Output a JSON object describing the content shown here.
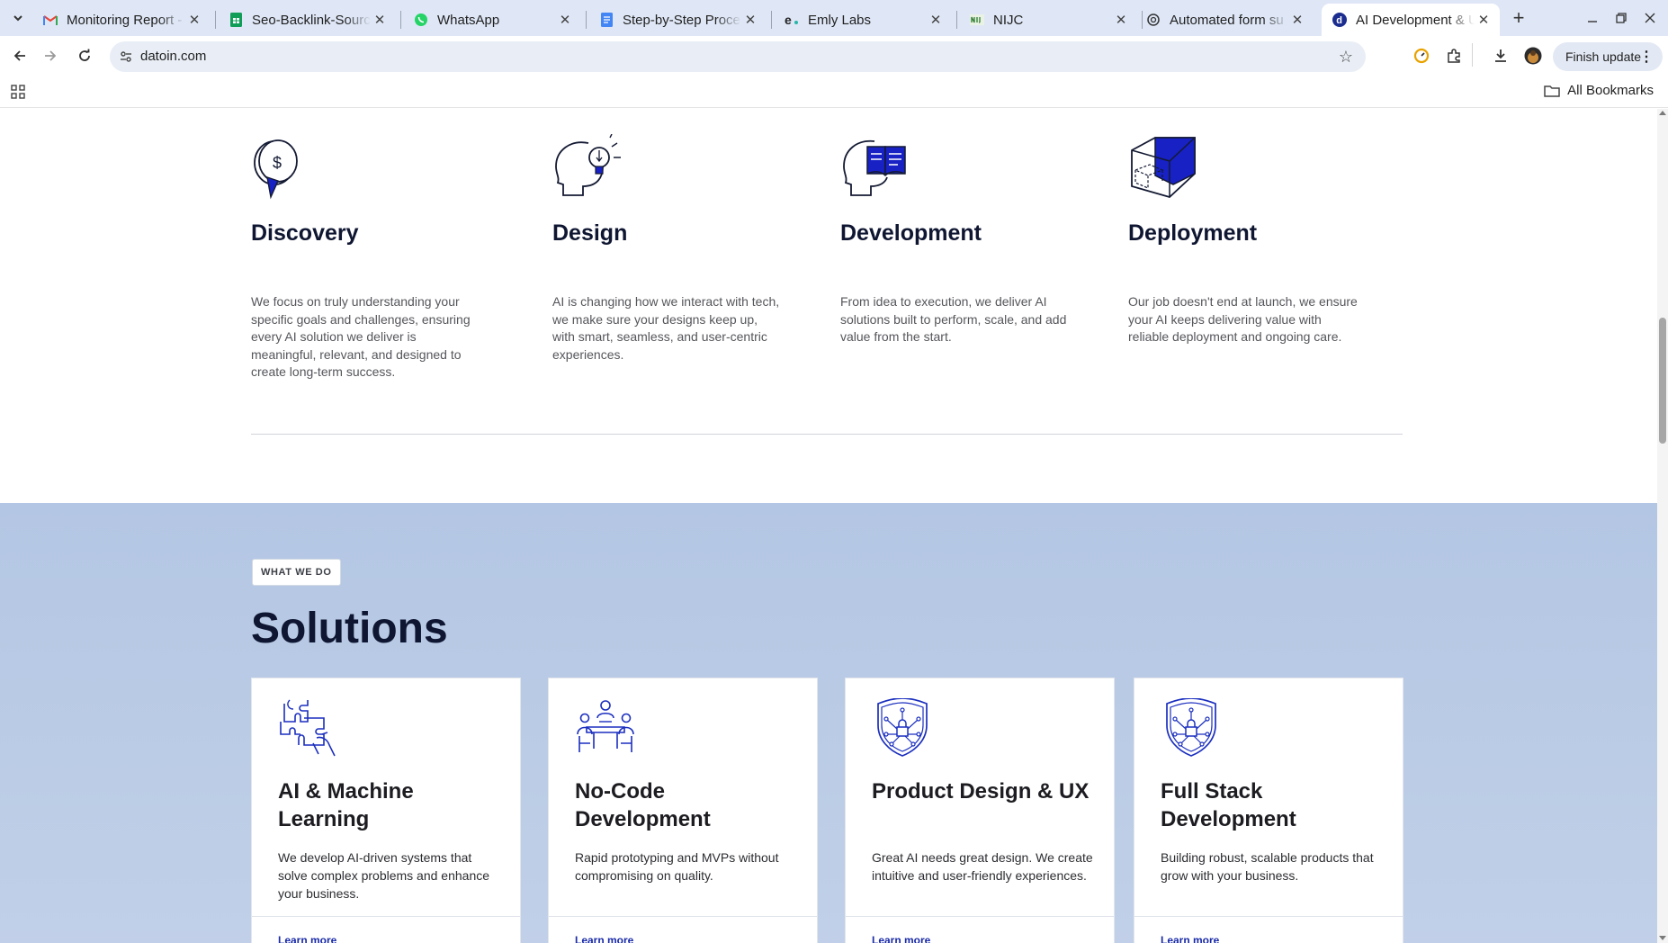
{
  "browser": {
    "tabs": [
      {
        "title": "Monitoring Report -",
        "icon": "gmail-icon"
      },
      {
        "title": "Seo-Backlink-Source",
        "icon": "sheets-icon"
      },
      {
        "title": "WhatsApp",
        "icon": "whatsapp-icon"
      },
      {
        "title": "Step-by-Step Proce",
        "icon": "docs-icon"
      },
      {
        "title": "Emly Labs",
        "icon": "emly-icon"
      },
      {
        "title": "NIJC",
        "icon": "nijc-icon"
      },
      {
        "title": "Automated form su",
        "icon": "openai-icon"
      },
      {
        "title": "AI Development & U",
        "icon": "datoin-icon"
      }
    ],
    "active_tab": 7,
    "close_glyph": "✕",
    "new_tab_glyph": "+",
    "url": "datoin.com",
    "finish_update_label": "Finish update",
    "all_bookmarks_label": "All Bookmarks",
    "accent_color": "#1a2ba8"
  },
  "process": {
    "steps": [
      {
        "title": "Discovery",
        "text": "We focus on truly understanding your specific goals and challenges, ensuring every AI solution we deliver is meaningful, relevant, and designed to create long-term success.",
        "icon": "coin-idea-icon"
      },
      {
        "title": "Design",
        "text": "AI is changing how we interact with tech, we make sure your designs keep up, with smart, seamless, and user-centric experiences.",
        "icon": "head-lightbulb-icon"
      },
      {
        "title": "Development",
        "text": "From idea to execution, we deliver AI solutions built to perform, scale, and add value from the start.",
        "icon": "head-book-icon"
      },
      {
        "title": "Deployment",
        "text": "Our job doesn't end at launch, we ensure your AI keeps delivering value with reliable deployment and ongoing care.",
        "icon": "box-cube-icon"
      }
    ]
  },
  "solutions": {
    "badge": "WHAT WE DO",
    "title": "Solutions",
    "cards": [
      {
        "title": "AI & Machine Learning",
        "text": "We develop AI-driven systems that solve complex problems and enhance your business.",
        "link": "Learn more",
        "icon": "puzzle-hands-icon"
      },
      {
        "title": "No-Code Development",
        "text": "Rapid prototyping and MVPs without compromising on quality.",
        "link": "Learn more",
        "icon": "team-meeting-icon"
      },
      {
        "title": "Product Design & UX",
        "text": "Great AI needs great design. We create intuitive and user-friendly experiences.",
        "link": "Learn more",
        "icon": "shield-lock-icon"
      },
      {
        "title": "Full Stack Development",
        "text": "Building robust, scalable products that grow with your business.",
        "link": "Learn more",
        "icon": "shield-lock-icon"
      }
    ]
  }
}
